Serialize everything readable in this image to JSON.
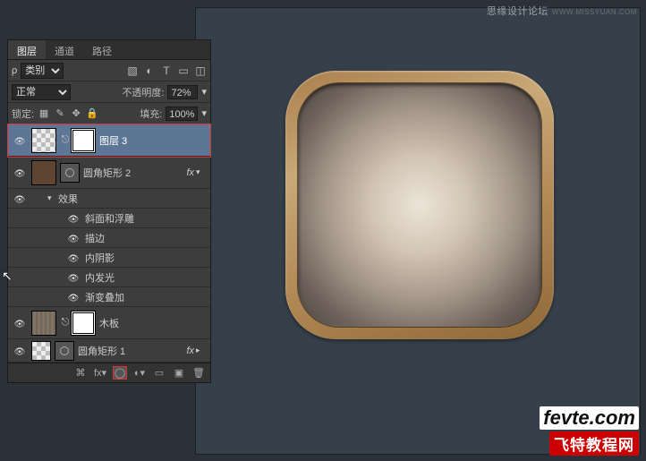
{
  "watermark": {
    "top": "思缘设计论坛",
    "top_sub": "WWW.MISSYUAN.COM",
    "b1": "fevte.com",
    "b2": "飞特教程网"
  },
  "tabs": {
    "layers": "图层",
    "channels": "通道",
    "paths": "路径"
  },
  "filter": {
    "label": "类别"
  },
  "blend": {
    "mode": "正常",
    "opacity_label": "不透明度:",
    "opacity": "72%"
  },
  "lock": {
    "label": "锁定:",
    "fill_label": "填充:",
    "fill": "100%"
  },
  "layers": {
    "l1": "图层 3",
    "l2": "圆角矩形 2",
    "fx": "fx",
    "fx_header": "效果",
    "fx1": "斜面和浮雕",
    "fx2": "描边",
    "fx3": "内阴影",
    "fx4": "内发光",
    "fx5": "渐变叠加",
    "l3": "木板",
    "l4": "圆角矩形 1"
  }
}
